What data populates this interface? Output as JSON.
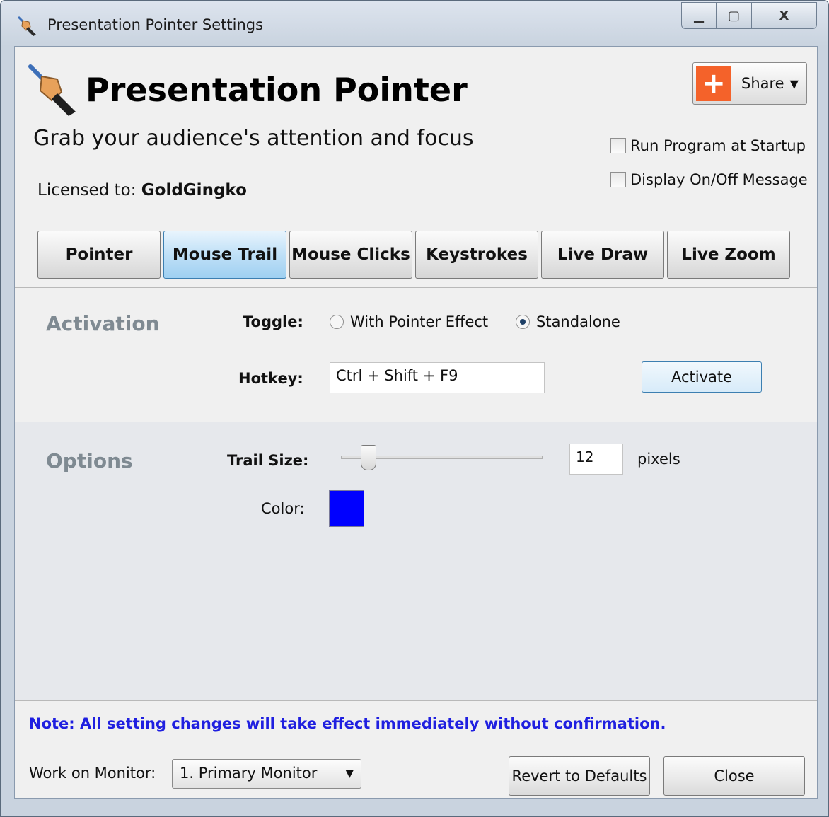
{
  "window": {
    "title": "Presentation Pointer Settings",
    "controls": {
      "minimize": "▁",
      "maximize": "▢",
      "close": "X"
    }
  },
  "header": {
    "app_title": "Presentation Pointer",
    "tagline": "Grab your audience's attention and focus",
    "license_label": "Licensed to:",
    "license_name": "GoldGingko",
    "share": {
      "label": "Share",
      "icon": "plus-icon",
      "plus": "+",
      "caret": "▼"
    },
    "run_at_startup": {
      "label": "Run Program at Startup",
      "checked": false
    },
    "display_message": {
      "label": "Display On/Off Message",
      "checked": false
    }
  },
  "tabs": [
    {
      "label": "Pointer",
      "active": false
    },
    {
      "label": "Mouse Trail",
      "active": true
    },
    {
      "label": "Mouse Clicks",
      "active": false
    },
    {
      "label": "Keystrokes",
      "active": false
    },
    {
      "label": "Live Draw",
      "active": false
    },
    {
      "label": "Live Zoom",
      "active": false
    }
  ],
  "activation": {
    "title": "Activation",
    "toggle_label": "Toggle:",
    "toggle_options": [
      {
        "label": "With Pointer Effect",
        "checked": false
      },
      {
        "label": "Standalone",
        "checked": true
      }
    ],
    "hotkey_label": "Hotkey:",
    "hotkey_value": "Ctrl + Shift + F9",
    "activate_button": "Activate"
  },
  "options": {
    "title": "Options",
    "trail_size_label": "Trail Size:",
    "trail_size_value": "12",
    "trail_size_unit": "pixels",
    "color_label": "Color:",
    "color_value": "#0000ff"
  },
  "footer": {
    "note": "Note: All setting changes will take effect immediately without confirmation.",
    "monitor_label": "Work on Monitor:",
    "monitor_value": "1. Primary Monitor",
    "monitor_caret": "▼",
    "revert_button": "Revert to Defaults",
    "close_button": "Close"
  }
}
